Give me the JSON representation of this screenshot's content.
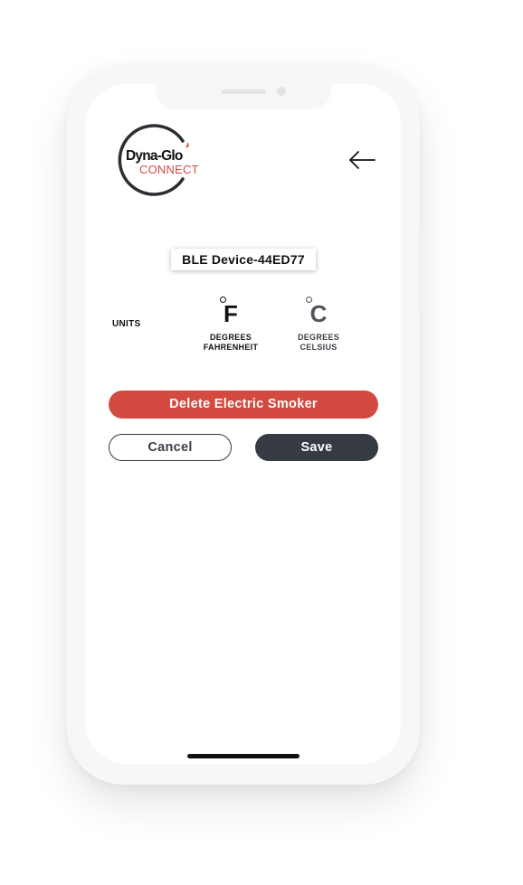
{
  "header": {
    "logo_text_primary": "Dyna-Glo",
    "logo_text_secondary": "CONNECT",
    "back_icon": "arrow-left-icon"
  },
  "device": {
    "name": "BLE Device-44ED77"
  },
  "units": {
    "label": "UNITS",
    "options": [
      {
        "symbol": "F",
        "line1": "DEGREES",
        "line2": "FAHRENHEIT",
        "selected": true
      },
      {
        "symbol": "C",
        "line1": "DEGREES",
        "line2": "CELSIUS",
        "selected": false
      }
    ]
  },
  "actions": {
    "delete_label": "Delete Electric Smoker",
    "cancel_label": "Cancel",
    "save_label": "Save"
  },
  "colors": {
    "brand_red": "#d24a40",
    "dark_button": "#353a43",
    "logo_ring": "#2b2e33"
  }
}
